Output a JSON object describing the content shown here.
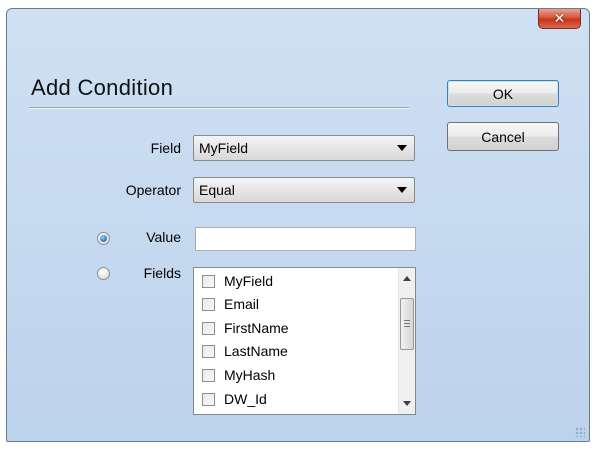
{
  "window": {
    "close_glyph": "✕"
  },
  "dialog": {
    "heading": "Add Condition"
  },
  "buttons": {
    "ok_label": "OK",
    "cancel_label": "Cancel"
  },
  "form": {
    "field_label": "Field",
    "field_value": "MyField",
    "operator_label": "Operator",
    "operator_value": "Equal",
    "value_label": "Value",
    "value_text": "",
    "fields_label": "Fields",
    "selected_mode": "Value"
  },
  "fields_list": {
    "items": [
      {
        "label": "MyField",
        "checked": false
      },
      {
        "label": "Email",
        "checked": false
      },
      {
        "label": "FirstName",
        "checked": false
      },
      {
        "label": "LastName",
        "checked": false
      },
      {
        "label": "MyHash",
        "checked": false
      },
      {
        "label": "DW_Id",
        "checked": false
      }
    ]
  },
  "colors": {
    "window_bg": "#c5d9ef",
    "close_button": "#c8341a",
    "radio_selected": "#2e7fc0"
  }
}
